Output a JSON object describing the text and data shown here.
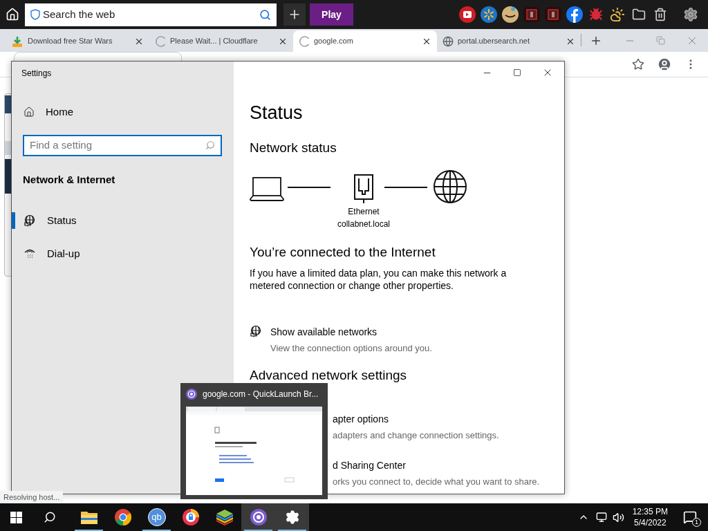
{
  "toolbar": {
    "search": {
      "placeholder": "Search the web"
    },
    "play_button": "Play",
    "extensions": [
      {
        "kind": "video",
        "color": "#cc1f26"
      },
      {
        "kind": "spark",
        "color": "#1f73c8"
      },
      {
        "kind": "smile",
        "color": "#d7b37a"
      },
      {
        "kind": "box",
        "color": "#5a1a1a"
      },
      {
        "kind": "box",
        "color": "#5a1a1a"
      },
      {
        "kind": "facebook",
        "color": "#1877f2"
      },
      {
        "kind": "bug",
        "color": "#d9283a"
      },
      {
        "kind": "weather",
        "color": "#f2c14e"
      },
      {
        "kind": "folder",
        "color": "#d0d0d0"
      },
      {
        "kind": "trash",
        "color": "#d0d0d0"
      }
    ]
  },
  "tabs": [
    {
      "title": "Download free Star Wars",
      "kind": "download",
      "selected": false
    },
    {
      "title": "Please Wait... | Cloudflare",
      "kind": "loading",
      "selected": false
    },
    {
      "title": "google.com",
      "kind": "loading",
      "selected": true
    },
    {
      "title": "portal.ubersearch.net",
      "kind": "globe",
      "selected": false
    }
  ],
  "status_bubble": "Resolving host...",
  "settings": {
    "window_title": "Settings",
    "home": "Home",
    "search": {
      "placeholder": "Find a setting"
    },
    "section": "Network & Internet",
    "nav": [
      {
        "label": "Status",
        "kind": "globe",
        "selected": true
      },
      {
        "label": "Dial-up",
        "kind": "dialup",
        "selected": false
      }
    ],
    "page_title": "Status",
    "network_status": "Network status",
    "diagram": {
      "adapter": "Ethernet",
      "network": "collabnet.local"
    },
    "connected_title": "You’re connected to the Internet",
    "connected_text": "If you have a limited data plan, you can make this network a metered connection or change other properties.",
    "links": [
      {
        "title": "Show available networks",
        "description": "View the connection options around you."
      }
    ],
    "advanced_title": "Advanced network settings",
    "advanced_items": [
      {
        "title": "apter options",
        "description": "adapters and change connection settings."
      },
      {
        "title": "d Sharing Center",
        "description": "orks you connect to, decide what you want to share."
      }
    ]
  },
  "preview": {
    "title": "google.com - QuickLaunch Br..."
  },
  "taskbar": {
    "apps": [
      {
        "kind": "explorer",
        "running": true,
        "selected": false
      },
      {
        "kind": "chrome",
        "running": false,
        "selected": false
      },
      {
        "kind": "qb",
        "label": "qb",
        "running": true,
        "selected": false
      },
      {
        "kind": "lock",
        "running": false,
        "selected": false
      },
      {
        "kind": "stack",
        "running": false,
        "selected": false
      },
      {
        "kind": "quicklaunch",
        "running": true,
        "selected": true
      },
      {
        "kind": "settings",
        "running": true,
        "selected": true
      }
    ],
    "time": "12:35 PM",
    "date": "5/4/2022",
    "notifications": "1"
  }
}
